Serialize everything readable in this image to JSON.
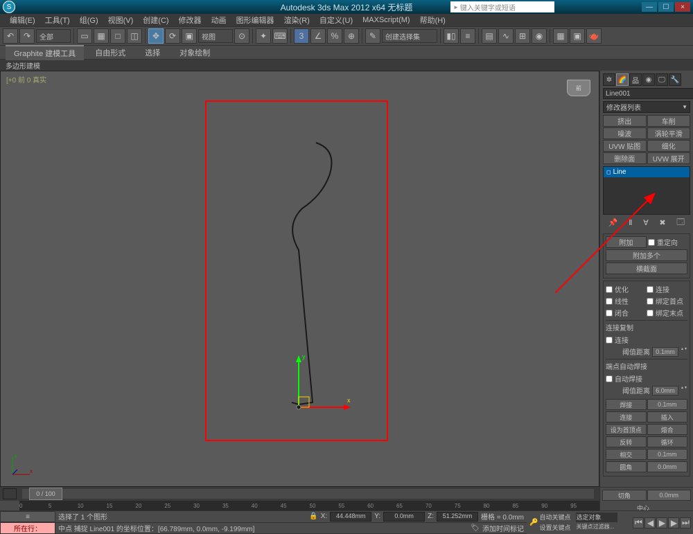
{
  "title": "Autodesk 3ds Max 2012 x64   无标题",
  "search_placeholder": "键入关键字或短语",
  "menu": [
    "编辑(E)",
    "工具(T)",
    "组(G)",
    "视图(V)",
    "创建(C)",
    "修改器",
    "动画",
    "图形编辑器",
    "渲染(R)",
    "自定义(U)",
    "MAXScript(M)",
    "帮助(H)"
  ],
  "toolbar_all": "全部",
  "toolbar_sel": "视图",
  "toolbar_create": "创建选择集",
  "tabs": [
    "Graphite 建模工具",
    "自由形式",
    "选择",
    "对象绘制"
  ],
  "subbar": "多边形建模",
  "viewport_label": "[+0 前 0 真实",
  "viewcube": "前",
  "object_name": "Line001",
  "modifier_list": "修改器列表",
  "mod_buttons": [
    "挤出",
    "车削",
    "噪波",
    "涡轮平滑",
    "UVW 贴图",
    "细化",
    "删除面",
    "UVW 展开"
  ],
  "stack_item": "Line",
  "attach": {
    "btn1": "附加",
    "btn2": "附加多个",
    "btn3": "横截面",
    "reorient": "重定向"
  },
  "opts": {
    "优化": "优化",
    "连接": "连接",
    "线性": "线性",
    "绑定首点": "绑定首点",
    "闭合": "闭合",
    "绑定末点": "绑定末点"
  },
  "copy": {
    "label": "连接复制",
    "connect": "连接",
    "thresh": "阈值距离",
    "thresh_val": "0.1mm"
  },
  "weld": {
    "label": "端点自动焊接",
    "auto": "自动焊接",
    "thresh": "阈值距离",
    "thresh_val": "6.0mm"
  },
  "actions": {
    "焊接": "焊接",
    "焊接v": "0.1mm",
    "连接": "连接",
    "插入": "插入",
    "设为首顶点": "设为首顶点",
    "熔合": "熔合",
    "反转": "反转",
    "循环": "循环",
    "相交": "相交",
    "相交v": "0.1mm",
    "圆角": "圆角",
    "圆角v": "0.0mm",
    "切角": "切角",
    "切角v": "0.0mm",
    "中心": "中心"
  },
  "slider": "0 / 100",
  "ruler_ticks": [
    "0",
    "5",
    "10",
    "15",
    "20",
    "25",
    "30",
    "35",
    "40",
    "45",
    "50",
    "55",
    "60",
    "65",
    "70",
    "75",
    "80",
    "85",
    "90",
    "95"
  ],
  "status": {
    "row1_icon": "所在行：",
    "sel": "选择了 1 个图形",
    "snap": "中点 捕捉 Line001 的坐标位置：[66.789mm, 0.0mm, -9.199mm]",
    "x": "44.448mm",
    "y": "0.0mm",
    "z": "51.252mm",
    "grid": "栅格 = 0.0mm",
    "addtime": "添加时间标记",
    "autokey": "自动关键点",
    "selobj": "选定对象",
    "setkey": "设置关键点",
    "keyfilter": "关键点过滤器..."
  }
}
